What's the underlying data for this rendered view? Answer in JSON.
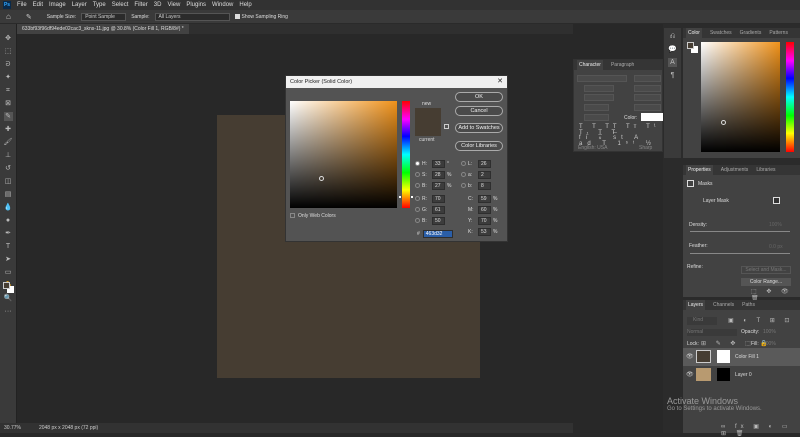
{
  "menubar": {
    "items": [
      "File",
      "Edit",
      "Image",
      "Layer",
      "Type",
      "Select",
      "Filter",
      "3D",
      "View",
      "Plugins",
      "Window",
      "Help"
    ]
  },
  "options": {
    "sample_size_label": "Sample Size:",
    "sample_size": "Point Sample",
    "sample_label": "Sample:",
    "sample": "All Layers",
    "show_ring": "Show Sampling Ring",
    "show_ring_checked": true
  },
  "document": {
    "tab": "633bf93f96df94ede02cac3_skns-11.jpg @ 30.8% (Color Fill 1, RGB/8#) *",
    "fill_color": "#463d32"
  },
  "status": {
    "zoom": "30.77%",
    "size": "2048 px x 2048 px (72 ppi)"
  },
  "color_picker": {
    "title": "Color Picker (Solid Color)",
    "ok": "OK",
    "cancel": "Cancel",
    "add_swatches": "Add to Swatches",
    "color_libraries": "Color Libraries",
    "new_label": "new",
    "current_label": "current",
    "only_web": "Only Web Colors",
    "fields": {
      "H": "33",
      "S": "28",
      "B": "27",
      "R": "70",
      "G": "61",
      "Bv": "50",
      "L": "26",
      "a": "2",
      "b": "8",
      "C": "59",
      "M": "60",
      "Y": "70",
      "K": "53"
    },
    "units": {
      "deg": "°",
      "pct": "%"
    },
    "hex_label": "#",
    "hex": "463d32",
    "selected": "H"
  },
  "character_panel": {
    "tabs": [
      "Character",
      "Paragraph"
    ],
    "color_label": "Color:",
    "language": "English: USA",
    "aa": "Sharp"
  },
  "color_panel": {
    "tabs": [
      "Color",
      "Swatches",
      "Gradients",
      "Patterns"
    ]
  },
  "properties_panel": {
    "tabs": [
      "Properties",
      "Adjustments",
      "Libraries"
    ],
    "section": "Masks",
    "layer_mask": "Layer Mask",
    "density_label": "Density:",
    "density": "100%",
    "feather_label": "Feather:",
    "feather": "0.0 px",
    "refine_label": "Refine:",
    "select_mask": "Select and Mask...",
    "color_range": "Color Range..."
  },
  "layers_panel": {
    "tabs": [
      "Layers",
      "Channels",
      "Paths"
    ],
    "search": "Kind",
    "blend": "Normal",
    "opacity_label": "Opacity:",
    "opacity": "100%",
    "lock_label": "Lock:",
    "fill_label": "Fill:",
    "fill": "100%",
    "layers": [
      {
        "name": "Color Fill 1",
        "selected": true
      },
      {
        "name": "Layer 0",
        "selected": false
      }
    ]
  },
  "watermark": {
    "title": "Activate Windows",
    "sub": "Go to Settings to activate Windows."
  }
}
